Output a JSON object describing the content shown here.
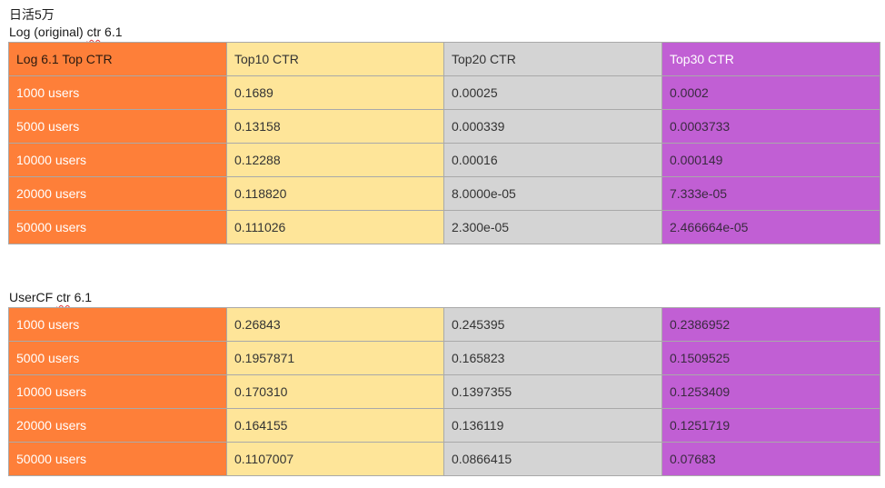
{
  "captions": {
    "dau": "日活5万",
    "log_prefix": "Log (original) ",
    "log_word": "ctr",
    "log_suffix": " 6.1",
    "usercf_prefix": "UserCF ",
    "usercf_word": "ctr",
    "usercf_suffix": " 6.1"
  },
  "log_table": {
    "header": [
      "Log 6.1 Top CTR",
      "Top10 CTR",
      "Top20 CTR",
      "Top30 CTR"
    ],
    "rows": [
      [
        "1000 users",
        "0.1689",
        "0.00025",
        "0.0002"
      ],
      [
        "5000 users",
        "0.13158",
        "0.000339",
        "0.0003733"
      ],
      [
        "10000 users",
        "0.12288",
        "0.00016",
        "0.000149"
      ],
      [
        "20000 users",
        "0.118820",
        "8.0000e-05",
        "7.333e-05"
      ],
      [
        "50000 users",
        "0.111026",
        "2.300e-05",
        "2.466664e-05"
      ]
    ]
  },
  "usercf_table": {
    "rows": [
      [
        "1000 users",
        "0.26843",
        "0.245395",
        "0.2386952"
      ],
      [
        "5000 users",
        "0.1957871",
        "0.165823",
        "0.1509525"
      ],
      [
        "10000 users",
        "0.170310",
        "0.1397355",
        "0.1253409"
      ],
      [
        "20000 users",
        "0.164155",
        "0.136119",
        "0.1251719"
      ],
      [
        "50000 users",
        "0.1107007",
        "0.0866415",
        "0.07683"
      ]
    ]
  },
  "colors": {
    "label_column": "#fe7f39",
    "top10_column": "#fee599",
    "top20_column": "#d4d4d4",
    "top30_column": "#c15fd4",
    "border": "#a9a9a9"
  }
}
